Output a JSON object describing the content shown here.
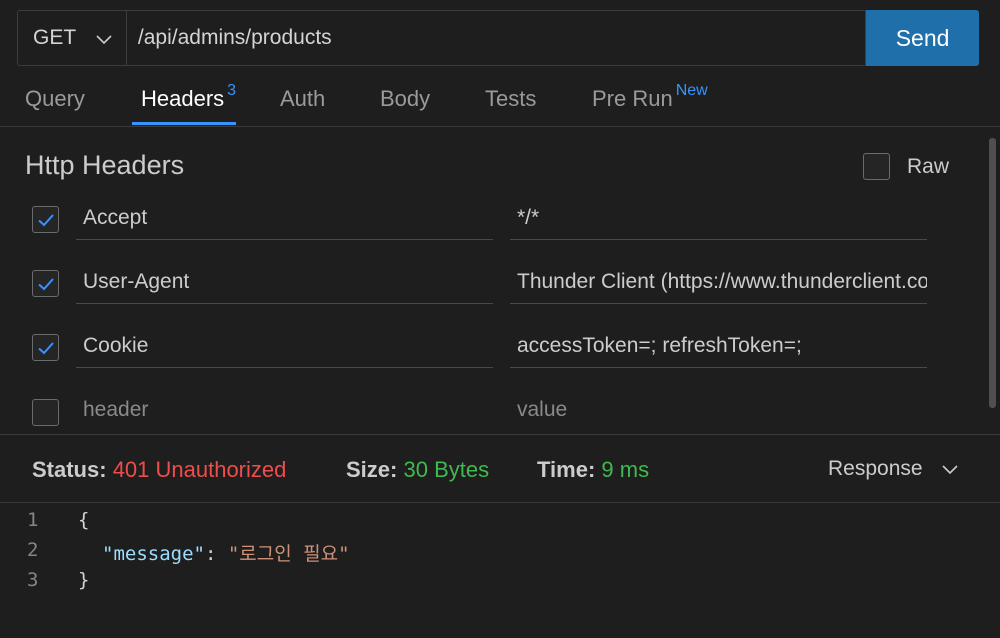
{
  "request": {
    "method": "GET",
    "url": "/api/admins/products",
    "send_label": "Send"
  },
  "tabs": [
    {
      "label": "Query",
      "badge": ""
    },
    {
      "label": "Headers",
      "badge": "3"
    },
    {
      "label": "Auth",
      "badge": ""
    },
    {
      "label": "Body",
      "badge": ""
    },
    {
      "label": "Tests",
      "badge": ""
    },
    {
      "label": "Pre Run",
      "badge": "New"
    }
  ],
  "active_tab": "Headers",
  "headers_section": {
    "title": "Http Headers",
    "raw_label": "Raw",
    "raw_checked": false,
    "rows": [
      {
        "key": "Accept",
        "value": "*/*",
        "checked": true
      },
      {
        "key": "User-Agent",
        "value": "Thunder Client (https://www.thunderclient.com)",
        "checked": true
      },
      {
        "key": "Cookie",
        "value": "accessToken=; refreshToken=;",
        "checked": true
      }
    ],
    "new_row": {
      "key_placeholder": "header",
      "value_placeholder": "value",
      "checked": false
    }
  },
  "response": {
    "status_label": "Status:",
    "status_value": "401 Unauthorized",
    "size_label": "Size:",
    "size_value": "30 Bytes",
    "time_label": "Time:",
    "time_value": "9 ms",
    "view_label": "Response",
    "status_color": "#f14c4c",
    "ok_color": "#3fb950",
    "body_lines": [
      {
        "num": "1",
        "open": "{"
      },
      {
        "num": "2",
        "key": "\"message\"",
        "colon": ": ",
        "value": "\"로그인 필요\""
      },
      {
        "num": "3",
        "close": "}"
      }
    ]
  },
  "accent_color": "#3794ff",
  "send_color": "#1f6fab"
}
